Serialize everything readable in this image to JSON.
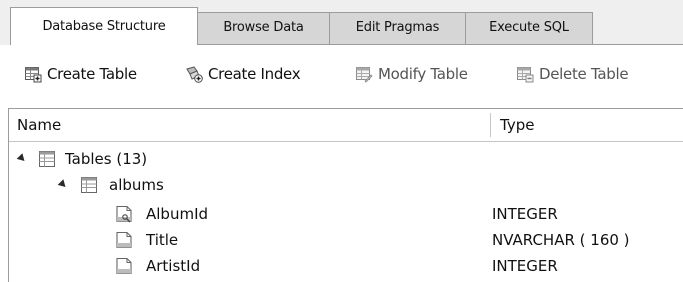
{
  "tabs": [
    {
      "label": "Database Structure",
      "active": true
    },
    {
      "label": "Browse Data",
      "active": false
    },
    {
      "label": "Edit Pragmas",
      "active": false
    },
    {
      "label": "Execute SQL",
      "active": false
    }
  ],
  "toolbar": {
    "create_table": {
      "label": "Create Table",
      "icon": "create-table-icon",
      "enabled": true
    },
    "create_index": {
      "label": "Create Index",
      "icon": "create-index-icon",
      "enabled": true
    },
    "modify_table": {
      "label": "Modify Table",
      "icon": "modify-table-icon",
      "enabled": false
    },
    "delete_table": {
      "label": "Delete Table",
      "icon": "delete-table-icon",
      "enabled": false
    }
  },
  "tree": {
    "columns": {
      "name": "Name",
      "type": "Type"
    },
    "rows": [
      {
        "label": "Tables (13)",
        "type": "",
        "icon": "table-list-icon",
        "expanded": true
      },
      {
        "label": "albums",
        "type": "",
        "icon": "table-icon",
        "expanded": true
      },
      {
        "label": "AlbumId",
        "type": "INTEGER",
        "icon": "primary-key-field-icon"
      },
      {
        "label": "Title",
        "type": "NVARCHAR ( 160 )",
        "icon": "field-icon"
      },
      {
        "label": "ArtistId",
        "type": "INTEGER",
        "icon": "field-icon"
      }
    ]
  },
  "colors": {
    "tab_active": "#ffffff",
    "tab_inactive": "#d6d6d6",
    "border": "#9c9c9c",
    "disabled_text": "#555555"
  }
}
